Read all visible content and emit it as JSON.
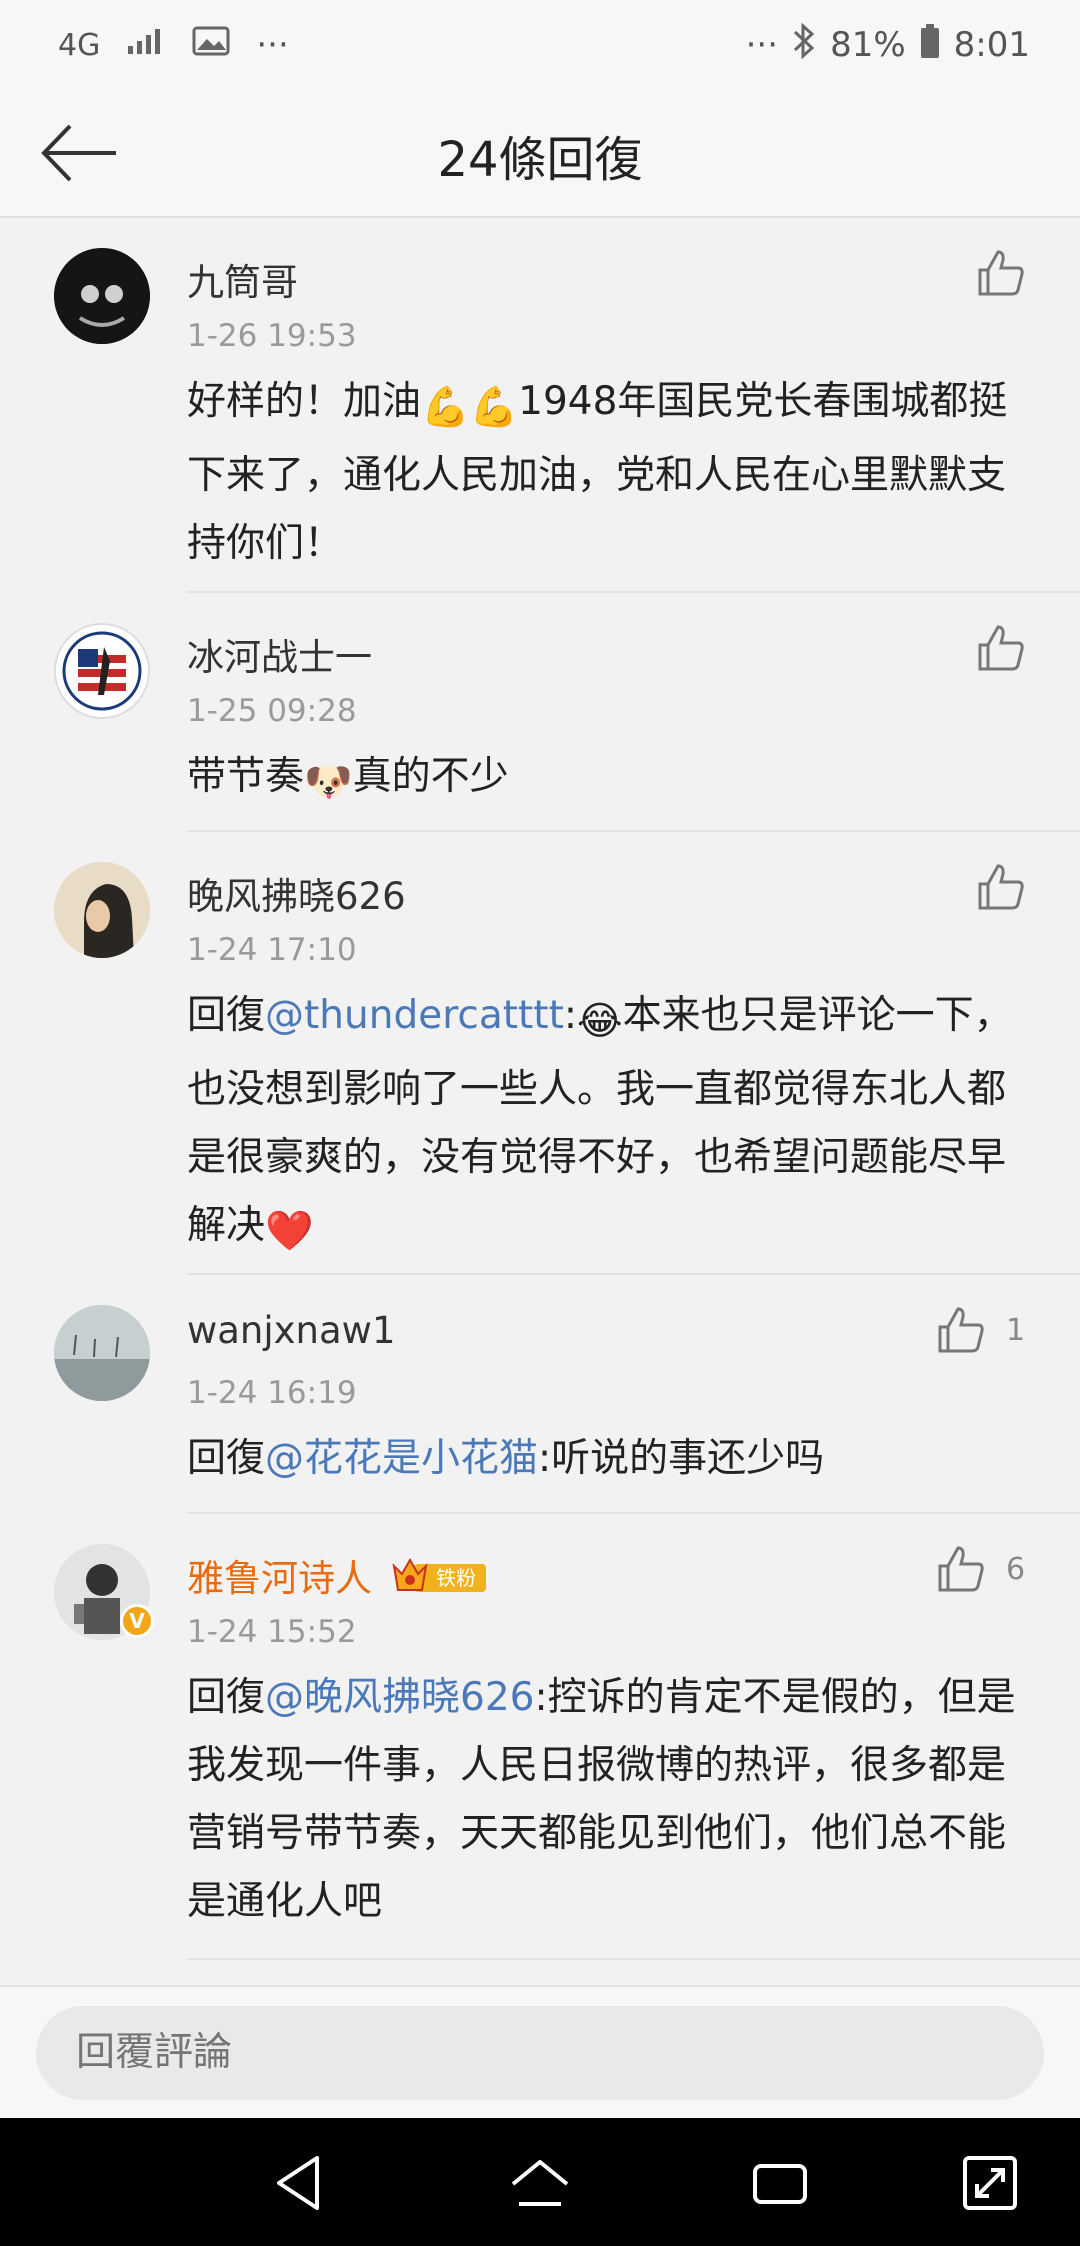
{
  "status_bar": {
    "network": "4G",
    "dots": "···",
    "battery": "81%",
    "time": "8:01"
  },
  "header": {
    "title": "24條回復",
    "back_icon": "arrow-left-icon"
  },
  "comments": [
    {
      "name": "九筒哥",
      "time": "1-26 19:53",
      "text_parts": [
        "好样的！加油",
        "💪💪",
        "1948年国民党长春围城都挺下来了，通化人民加油，党和人民在心里默默支持你们！"
      ],
      "likes": ""
    },
    {
      "name": "冰河战士一",
      "time": "1-25 09:28",
      "text_parts": [
        "带节奏",
        "🐶",
        "真的不少"
      ],
      "likes": ""
    },
    {
      "name": "晚风拂晓626",
      "time": "1-24 17:10",
      "reply_prefix": "回復",
      "mention": "@thundercatttt",
      "text_parts": [
        ":",
        "😂",
        "本来也只是评论一下，也没想到影响了一些人。我一直都觉得东北人都是很豪爽的，没有觉得不好，也希望问题能尽早解决",
        "❤️"
      ],
      "likes": ""
    },
    {
      "name": "wanjxnaw1",
      "time": "1-24 16:19",
      "reply_prefix": "回復",
      "mention": "@花花是小花猫",
      "text_parts": [
        ":听说的事还少吗"
      ],
      "likes": "1"
    },
    {
      "name": "雅鲁河诗人",
      "badge": "铁粉",
      "time": "1-24 15:52",
      "reply_prefix": "回復",
      "mention": "@晚风拂晓626",
      "text_parts": [
        ":控诉的肯定不是假的，但是我发现一件事，人民日报微博的热评，很多都是营销号带节奏，天天都能见到他们，他们总不能是通化人吧"
      ],
      "likes": "6"
    }
  ],
  "reply_bar": {
    "placeholder": "回覆評論"
  },
  "navbar": {
    "icons": [
      "back-triangle-icon",
      "home-icon",
      "recents-icon",
      "expand-icon"
    ]
  },
  "colors": {
    "mention": "#4a78b8",
    "vip_name": "#e86b10"
  }
}
